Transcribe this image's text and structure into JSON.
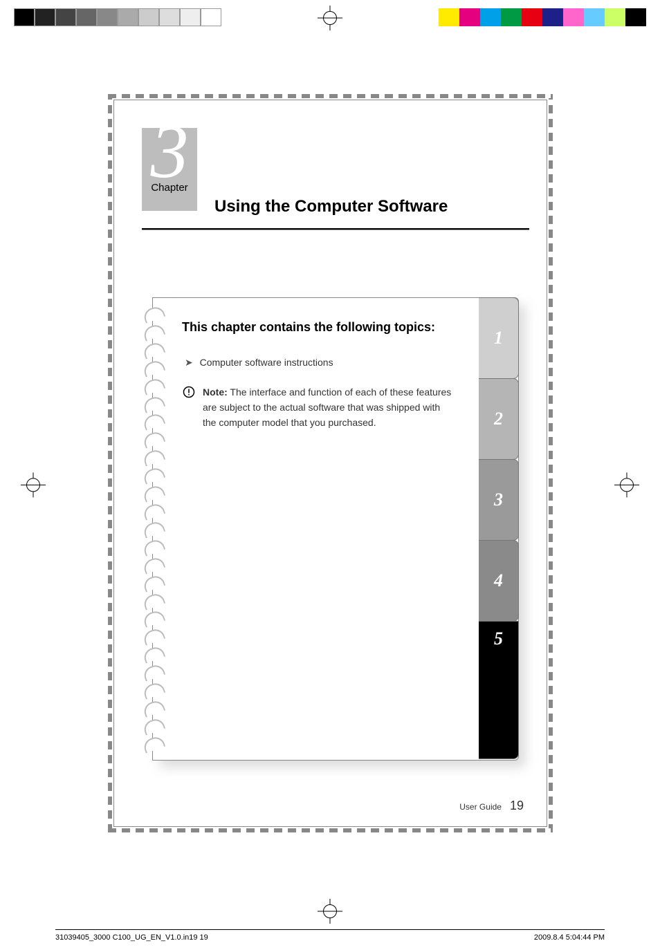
{
  "chapter": {
    "number": "3",
    "label": "Chapter",
    "title": "Using the Computer Software"
  },
  "card": {
    "heading": "This chapter contains the following topics:",
    "topics": [
      "Computer software instructions"
    ],
    "note_label": "Note:",
    "note_text": "The interface and function of each of these features are subject to the actual software that was shipped with the computer model that you purchased."
  },
  "tabs": [
    "1",
    "2",
    "3",
    "4",
    "5"
  ],
  "footer": {
    "label": "User Guide",
    "page": "19"
  },
  "meta": {
    "left": "31039405_3000 C100_UG_EN_V1.0.in19   19",
    "right": "2009.8.4   5:04:44 PM"
  }
}
